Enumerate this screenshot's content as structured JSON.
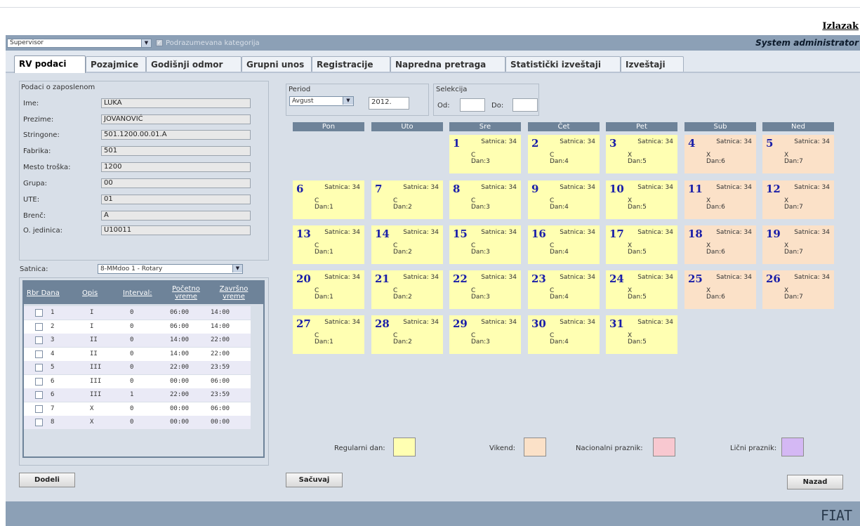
{
  "header": {
    "logout": "Izlazak",
    "user_role_select": "Supervisor",
    "default_category_label": "Podrazumevana kategorija",
    "system_user": "System administrator"
  },
  "tabs": [
    {
      "label": "RV podaci",
      "active": true
    },
    {
      "label": "Pozajmice",
      "active": false
    },
    {
      "label": "Godišnji odmor",
      "active": false
    },
    {
      "label": "Grupni unos",
      "active": false
    },
    {
      "label": "Registracije",
      "active": false
    },
    {
      "label": "Napredna pretraga",
      "active": false
    },
    {
      "label": "Statistički izveštaji",
      "active": false
    },
    {
      "label": "Izveštaji",
      "active": false
    }
  ],
  "employee": {
    "title": "Podaci o zaposlenom",
    "fields": [
      {
        "label": "Ime:",
        "value": "LUKA"
      },
      {
        "label": "Prezime:",
        "value": "JOVANOVIĆ"
      },
      {
        "label": "Stringone:",
        "value": "501.1200.00.01.A"
      },
      {
        "label": "Fabrika:",
        "value": "501"
      },
      {
        "label": "Mesto troška:",
        "value": "1200"
      },
      {
        "label": "Grupa:",
        "value": "00"
      },
      {
        "label": "UTE:",
        "value": "01"
      },
      {
        "label": "Brenč:",
        "value": "A"
      },
      {
        "label": "O. jedinica:",
        "value": "U10011"
      }
    ]
  },
  "satnica": {
    "label": "Satnica:",
    "selected": "8-MMdoo 1 - Rotary",
    "columns": {
      "rbr": "Rbr Dana",
      "opis": "Opis",
      "interval": "Interval:",
      "pocetno_1": "Početno",
      "pocetno_2": "vreme",
      "zavrsno_1": "Završno",
      "zavrsno_2": "vreme"
    },
    "rows": [
      {
        "rbr": "1",
        "opis": "I",
        "interval": "0",
        "start": "06:00",
        "end": "14:00"
      },
      {
        "rbr": "2",
        "opis": "I",
        "interval": "0",
        "start": "06:00",
        "end": "14:00"
      },
      {
        "rbr": "3",
        "opis": "II",
        "interval": "0",
        "start": "14:00",
        "end": "22:00"
      },
      {
        "rbr": "4",
        "opis": "II",
        "interval": "0",
        "start": "14:00",
        "end": "22:00"
      },
      {
        "rbr": "5",
        "opis": "III",
        "interval": "0",
        "start": "22:00",
        "end": "23:59"
      },
      {
        "rbr": "6",
        "opis": "III",
        "interval": "0",
        "start": "00:00",
        "end": "06:00"
      },
      {
        "rbr": "6",
        "opis": "III",
        "interval": "1",
        "start": "22:00",
        "end": "23:59"
      },
      {
        "rbr": "7",
        "opis": "X",
        "interval": "0",
        "start": "00:00",
        "end": "06:00"
      },
      {
        "rbr": "8",
        "opis": "X",
        "interval": "0",
        "start": "00:00",
        "end": "00:00"
      }
    ]
  },
  "buttons": {
    "dodeli": "Dodeli",
    "sacuvaj": "Sačuvaj",
    "nazad": "Nazad"
  },
  "period": {
    "label": "Period",
    "month": "Avgust",
    "year": "2012."
  },
  "selekcija": {
    "label": "Selekcija",
    "od_label": "Od:",
    "do_label": "Do:",
    "od_value": "",
    "do_value": ""
  },
  "weekdays": [
    "Pon",
    "Uto",
    "Sre",
    "Čet",
    "Pet",
    "Sub",
    "Ned"
  ],
  "calendar": {
    "first_weekday_index": 2,
    "days": [
      {
        "day": "1",
        "satnica": "Satnica: 34",
        "code": "C",
        "dan": "Dan:3",
        "type": "reg"
      },
      {
        "day": "2",
        "satnica": "Satnica: 34",
        "code": "C",
        "dan": "Dan:4",
        "type": "reg"
      },
      {
        "day": "3",
        "satnica": "Satnica: 34",
        "code": "X",
        "dan": "Dan:5",
        "type": "reg"
      },
      {
        "day": "4",
        "satnica": "Satnica: 34",
        "code": "X",
        "dan": "Dan:6",
        "type": "wk"
      },
      {
        "day": "5",
        "satnica": "Satnica: 34",
        "code": "X",
        "dan": "Dan:7",
        "type": "wk"
      },
      {
        "day": "6",
        "satnica": "Satnica: 34",
        "code": "C",
        "dan": "Dan:1",
        "type": "reg"
      },
      {
        "day": "7",
        "satnica": "Satnica: 34",
        "code": "C",
        "dan": "Dan:2",
        "type": "reg"
      },
      {
        "day": "8",
        "satnica": "Satnica: 34",
        "code": "C",
        "dan": "Dan:3",
        "type": "reg"
      },
      {
        "day": "9",
        "satnica": "Satnica: 34",
        "code": "C",
        "dan": "Dan:4",
        "type": "reg"
      },
      {
        "day": "10",
        "satnica": "Satnica: 34",
        "code": "X",
        "dan": "Dan:5",
        "type": "reg"
      },
      {
        "day": "11",
        "satnica": "Satnica: 34",
        "code": "X",
        "dan": "Dan:6",
        "type": "wk"
      },
      {
        "day": "12",
        "satnica": "Satnica: 34",
        "code": "X",
        "dan": "Dan:7",
        "type": "wk"
      },
      {
        "day": "13",
        "satnica": "Satnica: 34",
        "code": "C",
        "dan": "Dan:1",
        "type": "reg"
      },
      {
        "day": "14",
        "satnica": "Satnica: 34",
        "code": "C",
        "dan": "Dan:2",
        "type": "reg"
      },
      {
        "day": "15",
        "satnica": "Satnica: 34",
        "code": "C",
        "dan": "Dan:3",
        "type": "reg"
      },
      {
        "day": "16",
        "satnica": "Satnica: 34",
        "code": "C",
        "dan": "Dan:4",
        "type": "reg"
      },
      {
        "day": "17",
        "satnica": "Satnica: 34",
        "code": "X",
        "dan": "Dan:5",
        "type": "reg"
      },
      {
        "day": "18",
        "satnica": "Satnica: 34",
        "code": "X",
        "dan": "Dan:6",
        "type": "wk"
      },
      {
        "day": "19",
        "satnica": "Satnica: 34",
        "code": "X",
        "dan": "Dan:7",
        "type": "wk"
      },
      {
        "day": "20",
        "satnica": "Satnica: 34",
        "code": "C",
        "dan": "Dan:1",
        "type": "reg"
      },
      {
        "day": "21",
        "satnica": "Satnica: 34",
        "code": "C",
        "dan": "Dan:2",
        "type": "reg"
      },
      {
        "day": "22",
        "satnica": "Satnica: 34",
        "code": "C",
        "dan": "Dan:3",
        "type": "reg"
      },
      {
        "day": "23",
        "satnica": "Satnica: 34",
        "code": "C",
        "dan": "Dan:4",
        "type": "reg"
      },
      {
        "day": "24",
        "satnica": "Satnica: 34",
        "code": "X",
        "dan": "Dan:5",
        "type": "reg"
      },
      {
        "day": "25",
        "satnica": "Satnica: 34",
        "code": "X",
        "dan": "Dan:6",
        "type": "wk"
      },
      {
        "day": "26",
        "satnica": "Satnica: 34",
        "code": "X",
        "dan": "Dan:7",
        "type": "wk"
      },
      {
        "day": "27",
        "satnica": "Satnica: 34",
        "code": "C",
        "dan": "Dan:1",
        "type": "reg"
      },
      {
        "day": "28",
        "satnica": "Satnica: 34",
        "code": "C",
        "dan": "Dan:2",
        "type": "reg"
      },
      {
        "day": "29",
        "satnica": "Satnica: 34",
        "code": "C",
        "dan": "Dan:3",
        "type": "reg"
      },
      {
        "day": "30",
        "satnica": "Satnica: 34",
        "code": "C",
        "dan": "Dan:4",
        "type": "reg"
      },
      {
        "day": "31",
        "satnica": "Satnica: 34",
        "code": "X",
        "dan": "Dan:5",
        "type": "reg"
      }
    ]
  },
  "legend": [
    {
      "label": "Regularni dan:",
      "color": "#ffffb2"
    },
    {
      "label": "Vikend:",
      "color": "#fbe1c8"
    },
    {
      "label": "Nacionalni praznik:",
      "color": "#f8c8d0"
    },
    {
      "label": "Lični praznik:",
      "color": "#d4b8f4"
    }
  ],
  "colors": {
    "header_bar": "#8ca0b6",
    "content_bg": "#d8dfe8",
    "regular_day": "#ffffb2",
    "weekend_day": "#fbe1c8",
    "day_number": "#1a1ea8"
  },
  "icons": {
    "dropdown": "chevron-down-icon",
    "checkbox": "checkbox-icon",
    "logo": "fiat-logo"
  },
  "logo_text": "FIAT"
}
